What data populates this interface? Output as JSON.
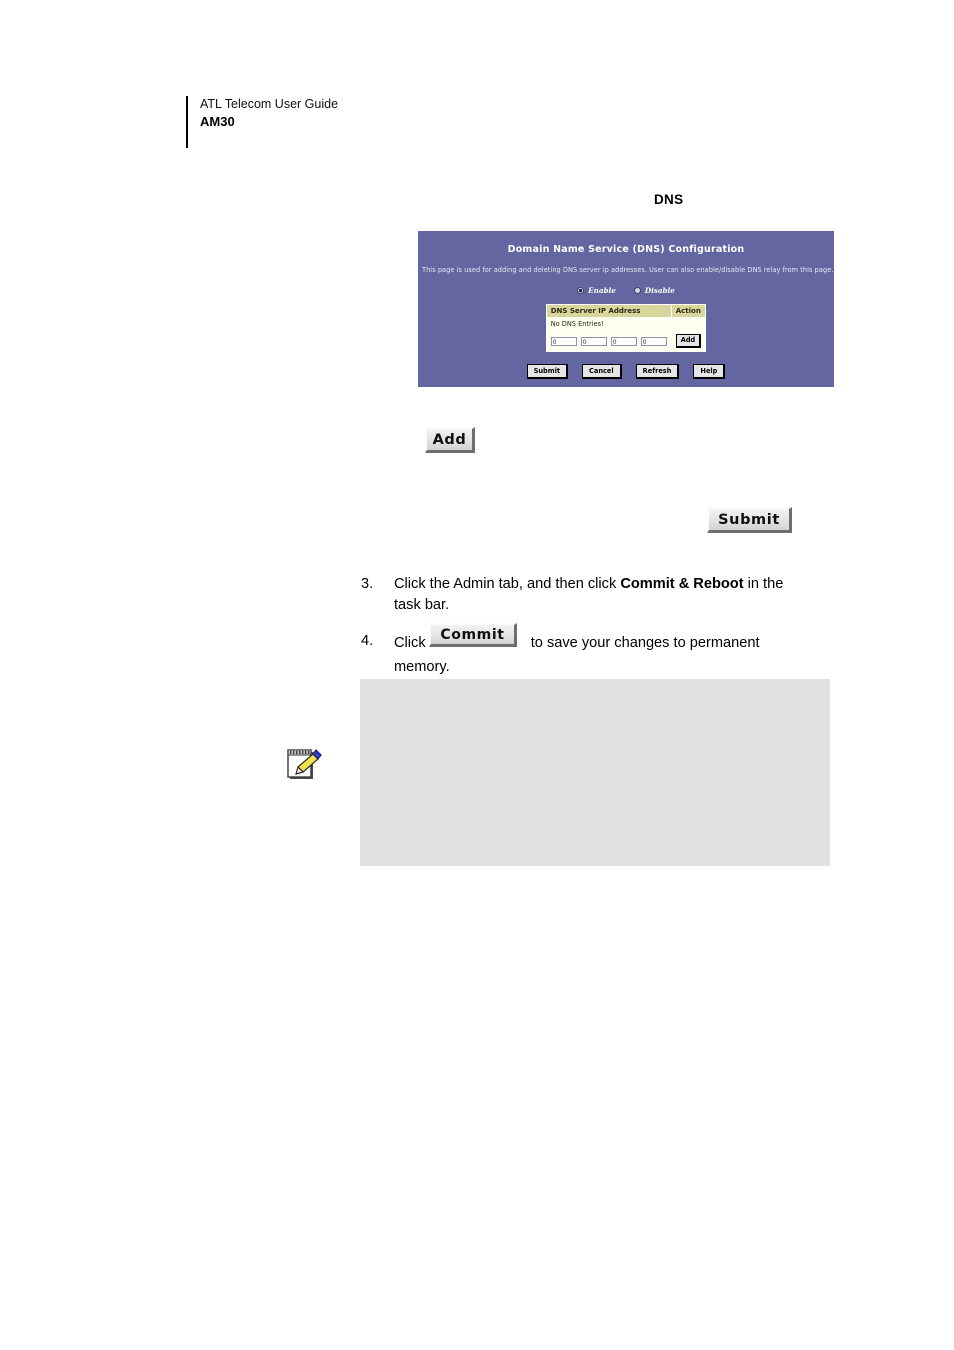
{
  "header": {
    "guide_line": "ATL Telecom User Guide",
    "model": "AM30"
  },
  "figure": {
    "caption": "DNS",
    "router_ui": {
      "title": "Domain Name Service (DNS) Configuration",
      "description": "This page is used for adding and deleting DNS server ip addresses. User can also enable/disable DNS relay from this page.",
      "radios": [
        {
          "label": "Enable",
          "selected": true
        },
        {
          "label": "Disable",
          "selected": false
        }
      ],
      "table": {
        "headers": [
          "DNS Server IP Address",
          "Action"
        ],
        "empty_message": "No DNS Entries!",
        "ip_octets": [
          "0",
          "0",
          "0",
          "0"
        ],
        "row_action_label": "Add"
      },
      "buttons": [
        "Submit",
        "Cancel",
        "Refresh",
        "Help"
      ],
      "colors": {
        "panel_background": "#6366a0",
        "table_header": "#d9d69b",
        "table_body": "#fffff0",
        "title_text": "#ffffff"
      }
    }
  },
  "button_graphics": {
    "add": "Add",
    "submit": "Submit",
    "commit": "Commit"
  },
  "steps": [
    {
      "number": "3.",
      "text_before": "Click the Admin tab, and then click ",
      "bold": "Commit & Reboot",
      "text_after": " in the task bar."
    },
    {
      "number": "4.",
      "text_before": "Click ",
      "text_after": " to save your changes to permanent memory."
    }
  ],
  "note": {
    "icon": "note-pencil-icon",
    "text": "",
    "background": "#e1e1e1"
  }
}
